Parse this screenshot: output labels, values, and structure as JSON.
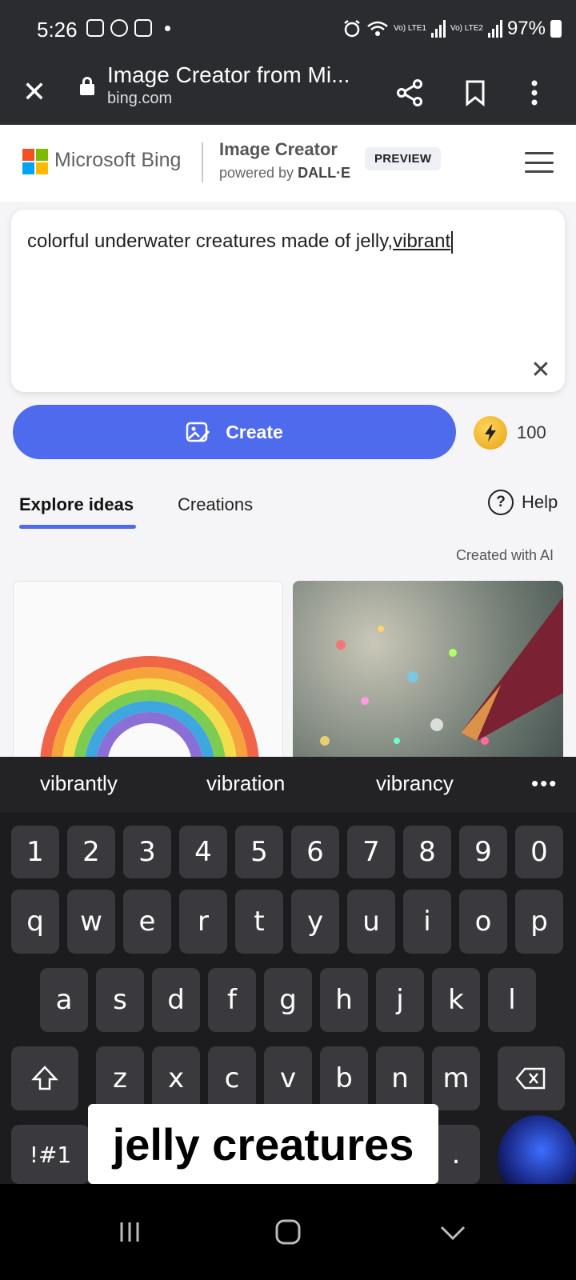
{
  "status_bar": {
    "time": "5:26",
    "battery": "97%",
    "sim1": "Vo) LTE1",
    "sim2": "Vo) LTE2"
  },
  "browser": {
    "title": "Image Creator from Mi...",
    "url": "bing.com"
  },
  "site": {
    "brand": "Microsoft Bing",
    "product_title": "Image Creator",
    "powered_by": "powered by",
    "powered_by_name": "DALL·E",
    "badge": "PREVIEW"
  },
  "prompt": {
    "text_before": "colorful underwater creatures made of jelly,",
    "text_current_word": "vibrant"
  },
  "create": {
    "label": "Create",
    "boosts": "100"
  },
  "tabs": {
    "explore": "Explore ideas",
    "creations": "Creations",
    "help": "Help"
  },
  "created_with_ai": "Created with AI",
  "keyboard": {
    "suggestions": [
      "vibrantly",
      "vibration",
      "vibrancy"
    ],
    "row_numbers": [
      "1",
      "2",
      "3",
      "4",
      "5",
      "6",
      "7",
      "8",
      "9",
      "0"
    ],
    "row1": [
      "q",
      "w",
      "e",
      "r",
      "t",
      "y",
      "u",
      "i",
      "o",
      "p"
    ],
    "row2": [
      "a",
      "s",
      "d",
      "f",
      "g",
      "h",
      "j",
      "k",
      "l"
    ],
    "row3": [
      "z",
      "x",
      "c",
      "v",
      "b",
      "n",
      "m"
    ],
    "symbols_key": "!#1",
    "period_key": "."
  },
  "caption": "jelly creatures"
}
